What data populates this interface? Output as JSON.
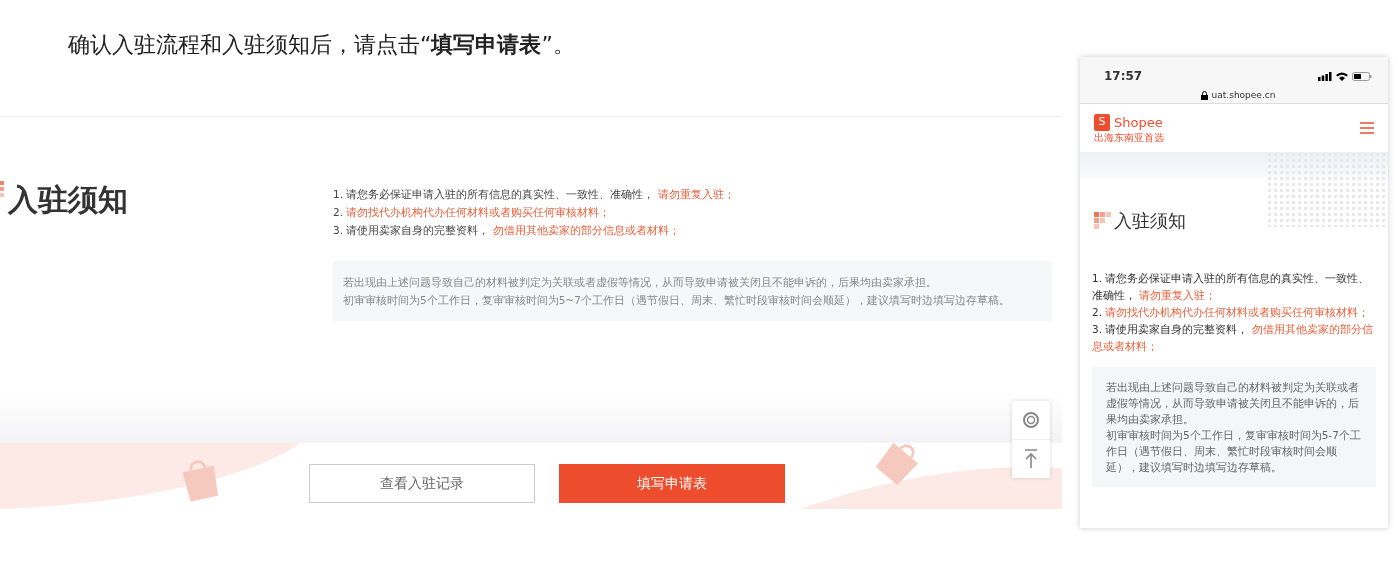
{
  "heading": "确认入驻流程和入驻须知后，请点击“**填写申请表**”。",
  "desktop": {
    "title": "入驻须知",
    "rules": [
      {
        "number": "1.",
        "text": "请您务必保证申请入驻的所有信息的真实性、一致性、准确性，",
        "warning": "请勿重复入驻；"
      },
      {
        "number": "2.",
        "warning": "请勿找代办机构代办任何材料或者购买任何审核材料；"
      },
      {
        "number": "3.",
        "text": "请使用卖家自身的完整资料，",
        "warning": "勿借用其他卖家的部分信息或者材料；"
      }
    ],
    "note_lines": [
      "若出现由上述问题导致自己的材料被判定为关联或者虚假等情况，从而导致申请被关闭且不能申诉的，后果均由卖家承担。",
      "初审审核时间为5个工作日，复审审核时间为5~7个工作日（遇节假日、周末、繁忙时段审核时间会顺延），建议填写时边填写边存草稿。"
    ],
    "buttons": [
      {
        "label": "查看入驻记录",
        "kind": "outline"
      },
      {
        "label": "填写申请表",
        "kind": "primary"
      }
    ]
  },
  "phone": {
    "time": "17:57",
    "url": "uat.shopee.cn",
    "logo_letter": "S",
    "brand": "Shopee",
    "slogan": "出海东南亚首选",
    "title": "入驻须知",
    "rules": [
      {
        "number": "1.",
        "text": "请您务必保证申请入驻的所有信息的真实性、一致性、准确性，",
        "warning": "请勿重复入驻；"
      },
      {
        "number": "2.",
        "warning": "请勿找代办机构代办任何材料或者购买任何审核材料；"
      },
      {
        "number": "3.",
        "text": "请使用卖家自身的完整资料，",
        "warning": "勿借用其他卖家的部分信息或者材料；"
      }
    ],
    "note_lines": [
      "若出现由上述问题导致自己的材料被判定为关联或者虚假等情况，从而导致申请被关闭且不能申诉的，后果均由卖家承担。",
      "初审审核时间为5个工作日，复审审核时间为5-7个工作日（遇节假日、周末、繁忙时段审核时间会顺延），建议填写时边填写边存草稿。"
    ]
  }
}
